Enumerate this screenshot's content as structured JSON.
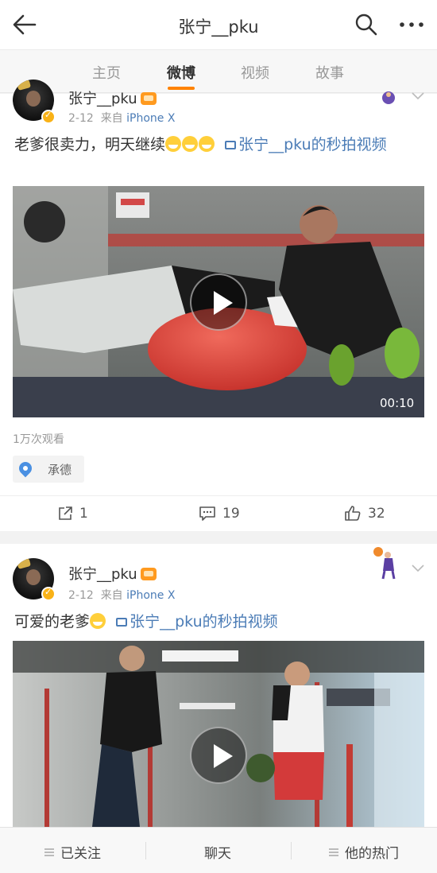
{
  "header": {
    "title": "张宁__pku"
  },
  "tabs": [
    {
      "label": "主页"
    },
    {
      "label": "微博"
    },
    {
      "label": "视频"
    },
    {
      "label": "故事"
    }
  ],
  "active_tab": "微博",
  "posts": [
    {
      "username": "张宁__pku",
      "date": "2-12",
      "source_prefix": "来自",
      "source": "iPhone X",
      "text": "老爹很卖力，明天继续",
      "emoji_count": 3,
      "link_text": "张宁__pku的秒拍视频",
      "duration": "00:10",
      "views": "1万次观看",
      "location": "承德",
      "reposts": "1",
      "comments": "19",
      "likes": "32"
    },
    {
      "username": "张宁__pku",
      "date": "2-12",
      "source_prefix": "来自",
      "source": "iPhone X",
      "text": "可爱的老爹",
      "link_text": "张宁__pku的秒拍视频"
    }
  ],
  "bottom_bar": {
    "follow": "已关注",
    "chat": "聊天",
    "hot": "他的热门"
  },
  "colors": {
    "accent": "#ff8200",
    "link": "#4b7cb6",
    "verified": "#f9b217"
  }
}
